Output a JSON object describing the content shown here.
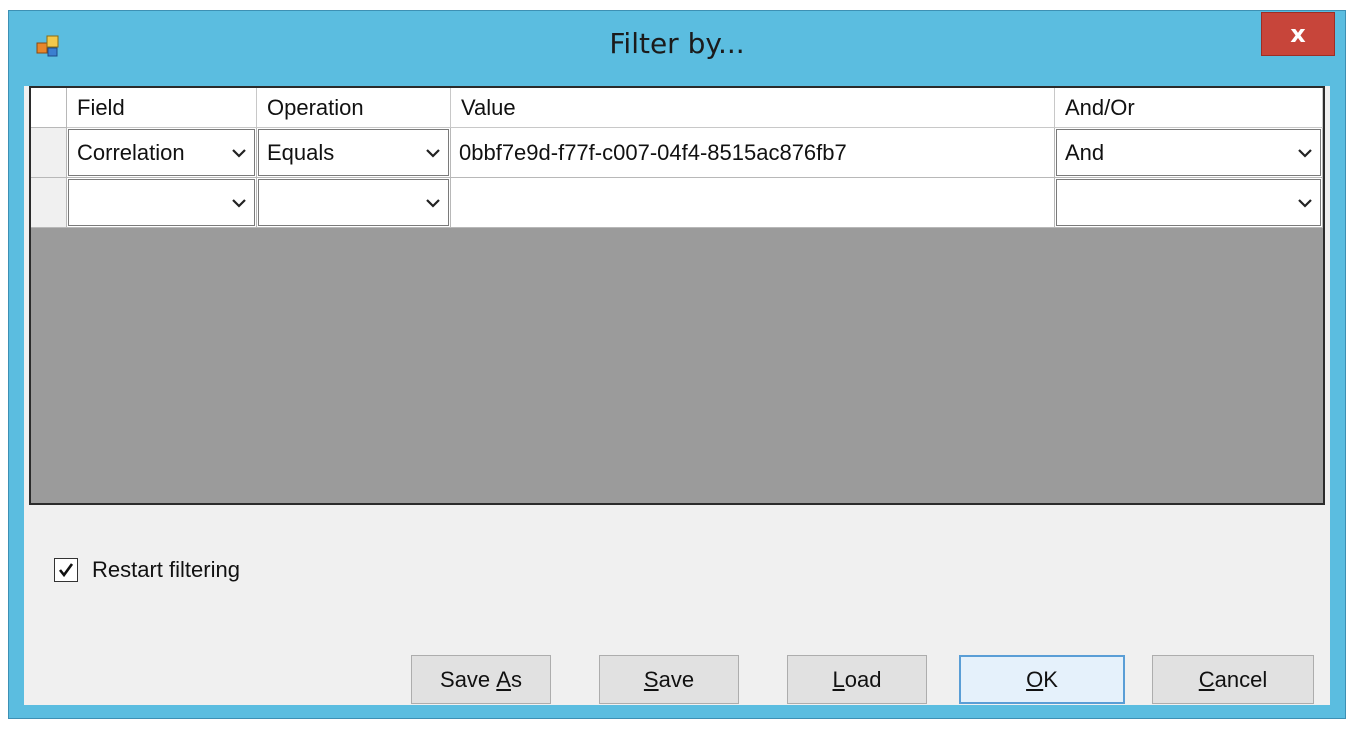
{
  "window": {
    "title": "Filter by...",
    "close_label": "x",
    "accent": "#5bbde0"
  },
  "grid": {
    "columns": [
      "Field",
      "Operation",
      "Value",
      "And/Or"
    ],
    "rows": [
      {
        "field": "Correlation",
        "operation": "Equals",
        "value": "0bbf7e9d-f77f-c007-04f4-8515ac876fb7",
        "andor": "And"
      },
      {
        "field": "",
        "operation": "",
        "value": "",
        "andor": ""
      }
    ]
  },
  "options": {
    "restart_label": "Restart filtering",
    "restart_checked": true
  },
  "buttons": {
    "save_as": {
      "pre": "Save ",
      "key": "A",
      "post": "s"
    },
    "save": {
      "pre": "",
      "key": "S",
      "post": "ave"
    },
    "load": {
      "pre": "",
      "key": "L",
      "post": "oad"
    },
    "ok": {
      "pre": "",
      "key": "O",
      "post": "K"
    },
    "cancel": {
      "pre": "",
      "key": "C",
      "post": "ancel"
    }
  }
}
